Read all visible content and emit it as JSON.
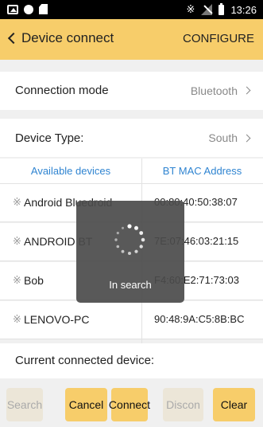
{
  "status_bar": {
    "time": "13:26",
    "icons": [
      "image-icon",
      "dot-icon",
      "sdcard-icon",
      "bluetooth-icon",
      "no-signal-icon",
      "battery-icon"
    ]
  },
  "header": {
    "back_label": "Device connect",
    "action_label": "CONFIGURE"
  },
  "connection_mode": {
    "label": "Connection mode",
    "value": "Bluetooth"
  },
  "device_type": {
    "label": "Device Type:",
    "value": "South"
  },
  "devices_table": {
    "headers": [
      "Available devices",
      "BT MAC Address"
    ],
    "rows": [
      {
        "name": "Android Bluedroid",
        "mac": "00:80:40:50:38:07"
      },
      {
        "name": "ANDROID BT",
        "mac": "7E:07:46:03:21:15"
      },
      {
        "name": "Bob",
        "mac": "F4:60:E2:71:73:03"
      },
      {
        "name": "LENOVO-PC",
        "mac": "90:48:9A:C5:8B:BC"
      }
    ]
  },
  "current_device": {
    "label": "Current connected device:"
  },
  "buttons": {
    "search": "Search",
    "cancel": "Cancel",
    "connect": "Connect",
    "disconnect": "Discon",
    "clear": "Clear"
  },
  "loading": {
    "text": "In search"
  },
  "colors": {
    "accent": "#f7cd6a",
    "link_blue": "#2f84d1",
    "background": "#f0f0f0"
  }
}
